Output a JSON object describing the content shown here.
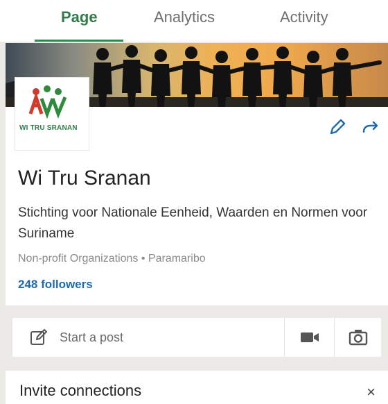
{
  "tabs": [
    {
      "label": "Page",
      "active": true
    },
    {
      "label": "Analytics",
      "active": false
    },
    {
      "label": "Activity",
      "active": false
    }
  ],
  "page": {
    "name": "Wi Tru Sranan",
    "description": "Stichting voor Nationale Eenheid, Waarden en Normen voor Suriname",
    "meta": "Non-profit Organizations • Paramaribo",
    "followers": "248 followers",
    "logo_text": "WI TRU SRANAN"
  },
  "post": {
    "placeholder": "Start a post"
  },
  "invite": {
    "title": "Invite connections",
    "close": "×"
  },
  "colors": {
    "accent_green": "#2f7d4a",
    "link_blue": "#1f6aa8"
  },
  "icons": [
    "edit-icon",
    "share-icon",
    "compose-icon",
    "video-icon",
    "camera-icon",
    "close-icon"
  ]
}
